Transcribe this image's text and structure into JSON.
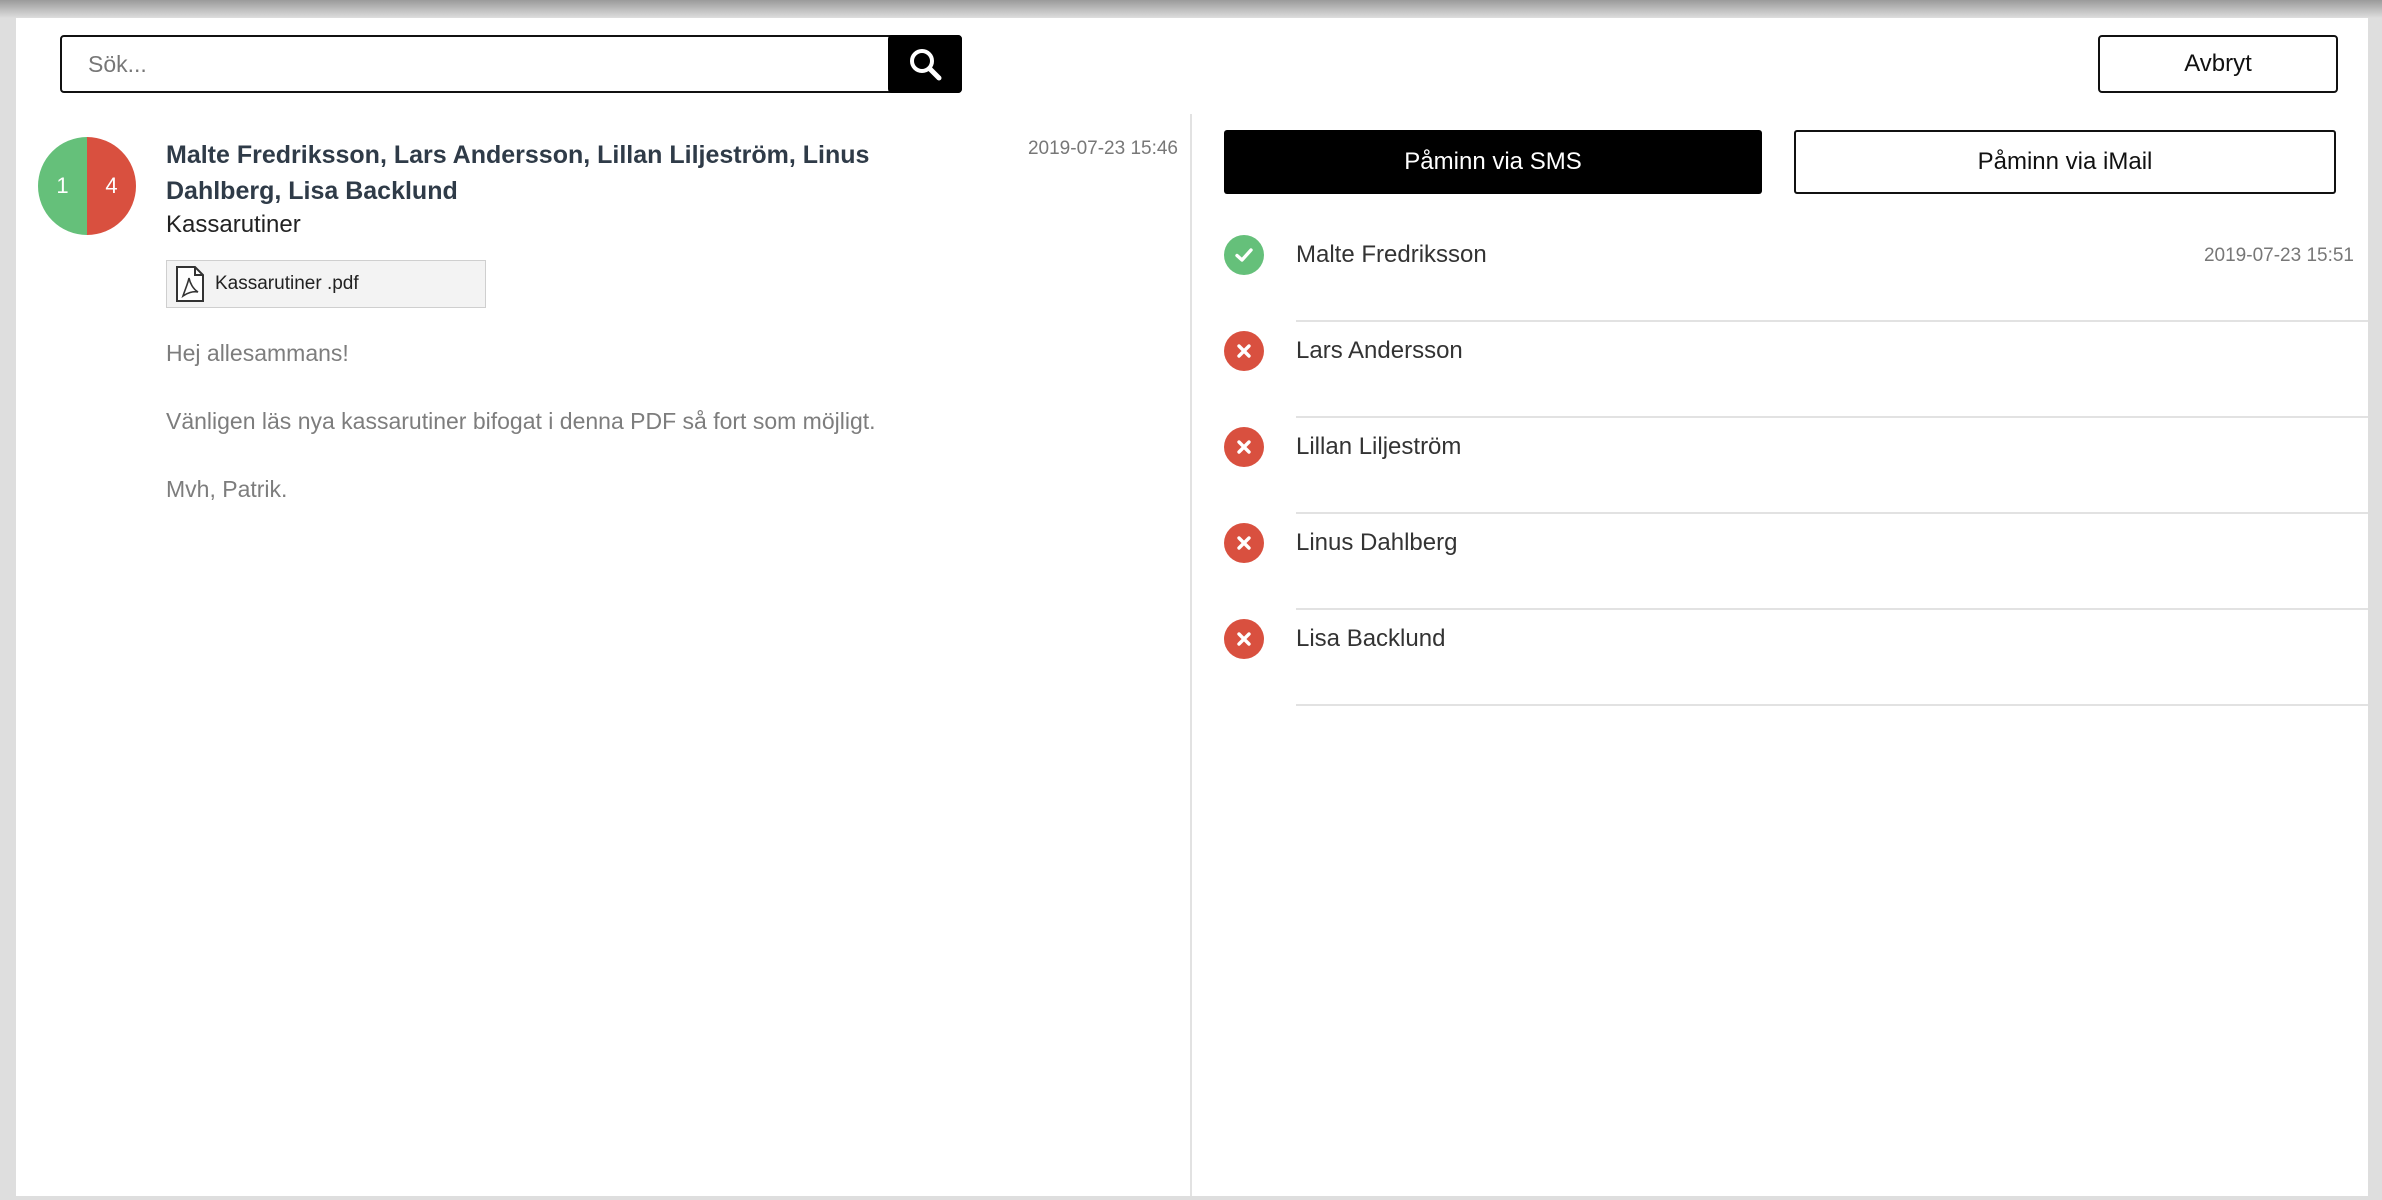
{
  "search": {
    "placeholder": "Sök...",
    "value": ""
  },
  "header": {
    "cancel_label": "Avbryt"
  },
  "message": {
    "stats": {
      "read": "1",
      "unread": "4"
    },
    "recipients": "Malte Fredriksson, Lars Andersson, Lillan Liljeström, Linus Dahlberg, Lisa Backlund",
    "date": "2019-07-23 15:46",
    "subject": "Kassarutiner",
    "attachment": {
      "name": "Kassarutiner .pdf",
      "icon": "pdf-file-icon"
    },
    "body": {
      "greeting": "Hej allesammans!",
      "text": "Vänligen läs nya kassarutiner bifogat i denna PDF så fort som möjligt.",
      "signoff": "Mvh, Patrik."
    }
  },
  "actions": {
    "sms_label": "Påminn via SMS",
    "mail_label": "Påminn via iMail"
  },
  "read_status": [
    {
      "name": "Malte Fredriksson",
      "status": "read",
      "time": "2019-07-23 15:51",
      "icon": "check-icon"
    },
    {
      "name": "Lars Andersson",
      "status": "unread",
      "time": "",
      "icon": "cross-icon"
    },
    {
      "name": "Lillan Liljeström",
      "status": "unread",
      "time": "",
      "icon": "cross-icon"
    },
    {
      "name": "Linus Dahlberg",
      "status": "unread",
      "time": "",
      "icon": "cross-icon"
    },
    {
      "name": "Lisa Backlund",
      "status": "unread",
      "time": "",
      "icon": "cross-icon"
    }
  ],
  "colors": {
    "read": "#65c07a",
    "unread": "#d9503f",
    "primary": "#000000"
  }
}
